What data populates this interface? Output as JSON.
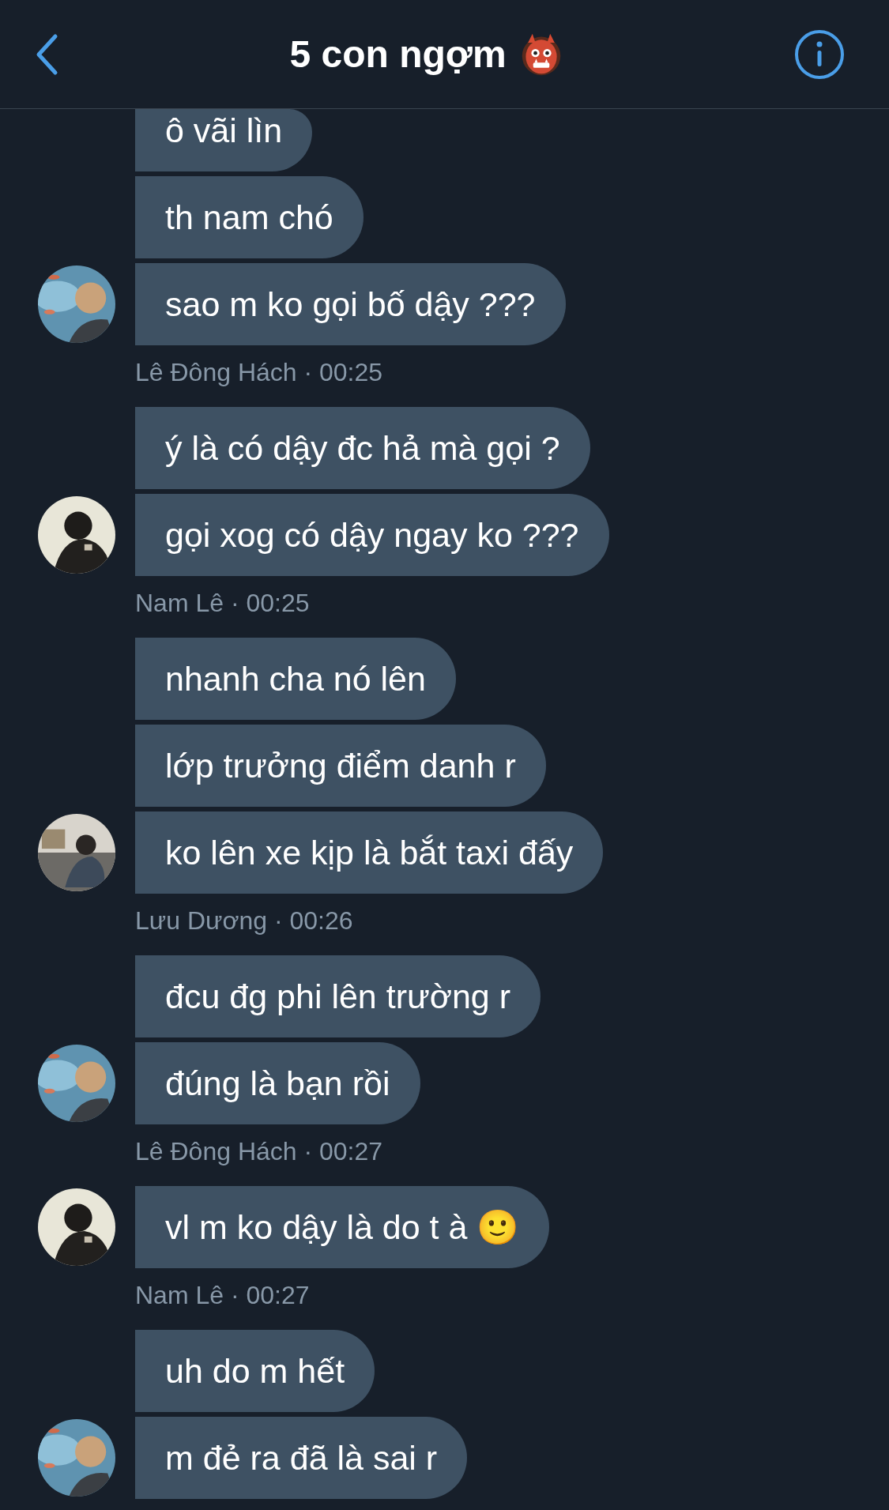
{
  "header": {
    "title": "5 con ngợm"
  },
  "groups": [
    {
      "messages": [
        "ô vãi lìn",
        "th nam chó",
        "sao m ko gọi bố dậy ???"
      ],
      "meta": "Lê Đông Hách · 00:25"
    },
    {
      "messages": [
        "ý là có dậy đc hả mà gọi ?",
        "gọi xog có dậy ngay ko ???"
      ],
      "meta": "Nam Lê · 00:25"
    },
    {
      "messages": [
        "nhanh cha nó lên",
        "lớp trưởng điểm danh r",
        "ko lên xe kịp là bắt taxi đấy"
      ],
      "meta": "Lưu Dương · 00:26"
    },
    {
      "messages": [
        "đcu đg phi lên trường r",
        "đúng là bạn rồi"
      ],
      "meta": "Lê Đông Hách · 00:27"
    },
    {
      "messages": [
        "vl m ko dậy là do t à 🙂"
      ],
      "meta": "Nam Lê · 00:27"
    },
    {
      "messages": [
        "uh do m hết",
        "m đẻ ra đã là sai r"
      ]
    }
  ]
}
